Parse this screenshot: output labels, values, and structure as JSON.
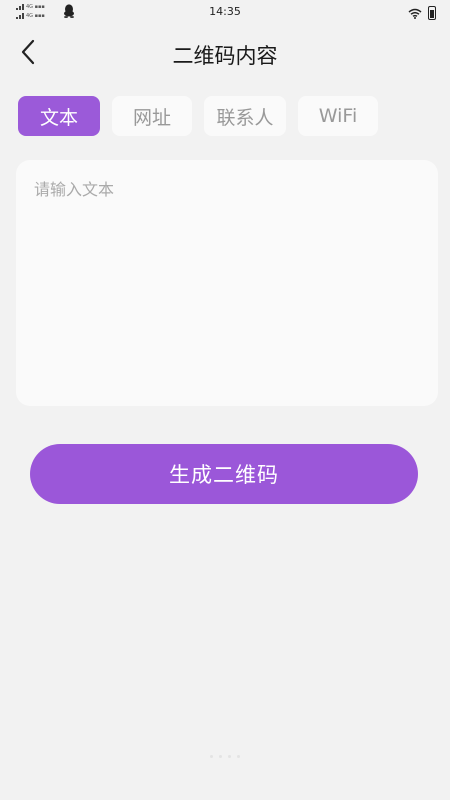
{
  "status_bar": {
    "time": "14:35",
    "icons": [
      "signal-icon",
      "qq-icon",
      "wifi-icon",
      "battery-icon"
    ]
  },
  "header": {
    "title": "二维码内容",
    "back_icon": "chevron-left-icon"
  },
  "tabs": [
    {
      "label": "文本",
      "active": true
    },
    {
      "label": "网址",
      "active": false
    },
    {
      "label": "联系人",
      "active": false
    },
    {
      "label": "WiFi",
      "active": false
    }
  ],
  "text_input": {
    "placeholder": "请输入文本",
    "value": ""
  },
  "generate_button": {
    "label": "生成二维码"
  },
  "colors": {
    "accent": "#9b5ad9",
    "background": "#f2f2f2",
    "card": "#fafafa",
    "inactive_text": "#999999"
  }
}
